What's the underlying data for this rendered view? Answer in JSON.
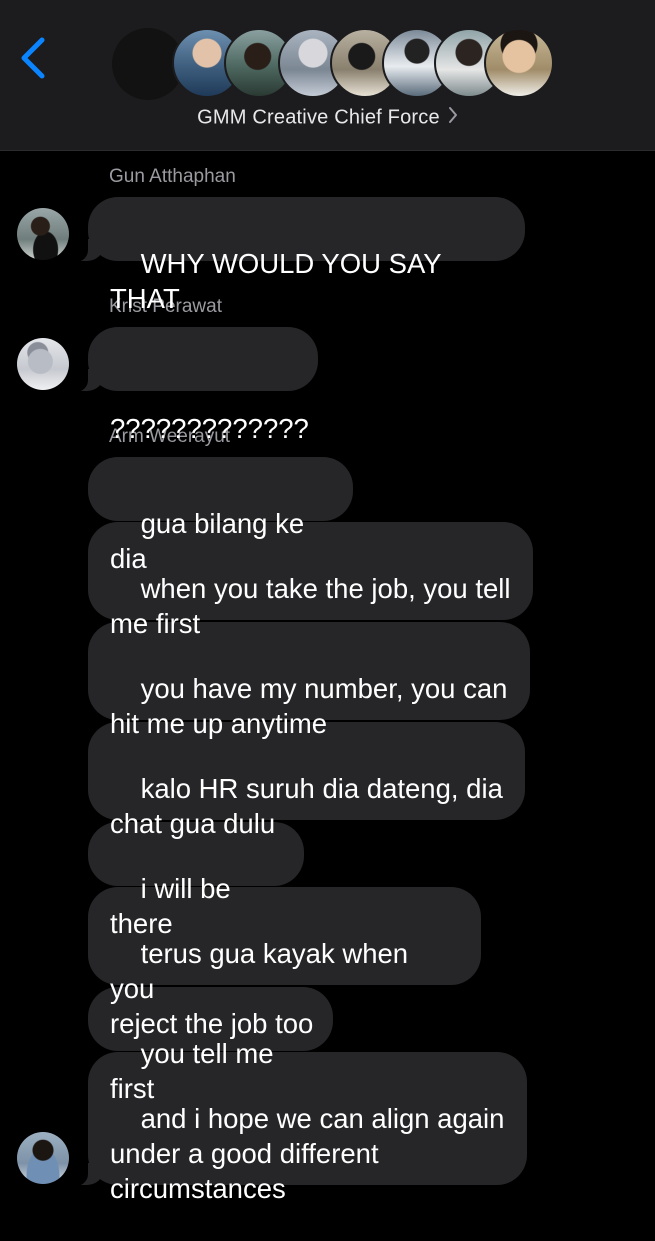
{
  "header": {
    "title": "GMM Creative Chief Force",
    "back_icon": "chevron-left-icon",
    "title_chevron_icon": "chevron-right-icon",
    "accent_color": "#0a84ff",
    "participant_avatars": [
      "blank",
      "blue-shirt",
      "beach",
      "grey-hood",
      "dark-hair",
      "white-shirt",
      "outdoor",
      "smiling"
    ]
  },
  "messages": [
    {
      "sender": "Gun Atthaphan",
      "bubbles": [
        "WHY WOULD YOU SAY THAT"
      ]
    },
    {
      "sender": "Krist Perawat",
      "bubbles": [
        "?????????????"
      ]
    },
    {
      "sender": "Arm Weerayut",
      "bubbles": [
        "gua bilang ke dia",
        "when you take the job, you tell\nme first",
        "you have my number, you can\nhit me up anytime",
        "kalo HR suruh dia dateng, dia\nchat gua dulu",
        "i will be there",
        "terus gua kayak when you\nreject the job too",
        "you tell me first",
        "and i hope we can align again\nunder a good different\ncircumstances"
      ]
    }
  ],
  "colors": {
    "background": "#000000",
    "header_background": "#1c1c1e",
    "bubble": "#262629",
    "sender_name": "#9a9aa0"
  }
}
